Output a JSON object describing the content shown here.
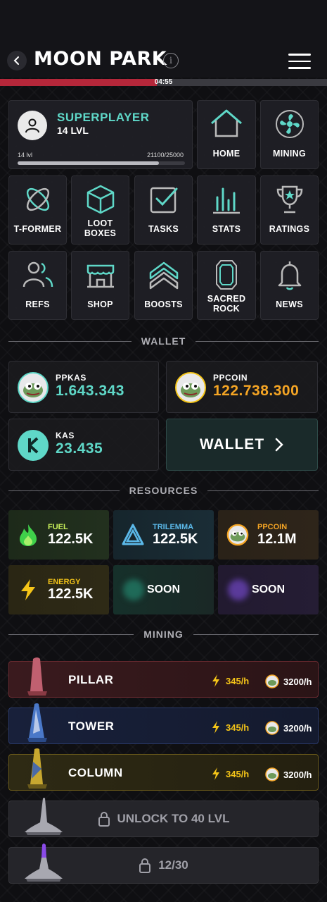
{
  "header": {
    "title": "MOON PARK",
    "timer": "04:55",
    "timer_progress": 0.48
  },
  "profile": {
    "name": "SUPERPLAYER",
    "level": "14 LVL",
    "level_short": "14 lvl",
    "xp_text": "21100/25000",
    "xp_progress": 0.844
  },
  "nav": {
    "home": "HOME",
    "mining": "MINING",
    "tformer": "T-FORMER",
    "loot": "LOOT BOXES",
    "tasks": "TASKS",
    "stats": "STATS",
    "ratings": "RATINGS",
    "refs": "REFS",
    "shop": "SHOP",
    "boosts": "BOOSTS",
    "sacred": "SACRED ROCK",
    "news": "NEWS"
  },
  "sections": {
    "wallet": "WALLET",
    "resources": "RESOURCES",
    "mining": "MINING"
  },
  "wallet": {
    "ppkas_label": "PPKAS",
    "ppkas_value": "1.643.343",
    "ppcoin_label": "PPCOIN",
    "ppcoin_value": "122.738.300",
    "kas_label": "KAS",
    "kas_value": "23.435",
    "button": "WALLET"
  },
  "resources": {
    "fuel_label": "FUEL",
    "fuel_value": "122.5K",
    "trilemma_label": "TRILEMMA",
    "trilemma_value": "122.5K",
    "ppcoin_label": "PPCOIN",
    "ppcoin_value": "12.1M",
    "energy_label": "ENERGY",
    "energy_value": "122.5K",
    "soon1": "SOON",
    "soon2": "SOON"
  },
  "mining": {
    "pillar": {
      "name": "PILLAR",
      "energy": "345/h",
      "coin": "3200/h"
    },
    "tower": {
      "name": "TOWER",
      "energy": "345/h",
      "coin": "3200/h"
    },
    "column": {
      "name": "COLUMN",
      "energy": "345/h",
      "coin": "3200/h"
    },
    "locked1": "UNLOCK TO 40 LVL",
    "locked2": "12/30"
  },
  "colors": {
    "accent": "#5fd8c8",
    "gold": "#f5a524",
    "energy": "#f5c518",
    "timer": "#b5273a"
  }
}
